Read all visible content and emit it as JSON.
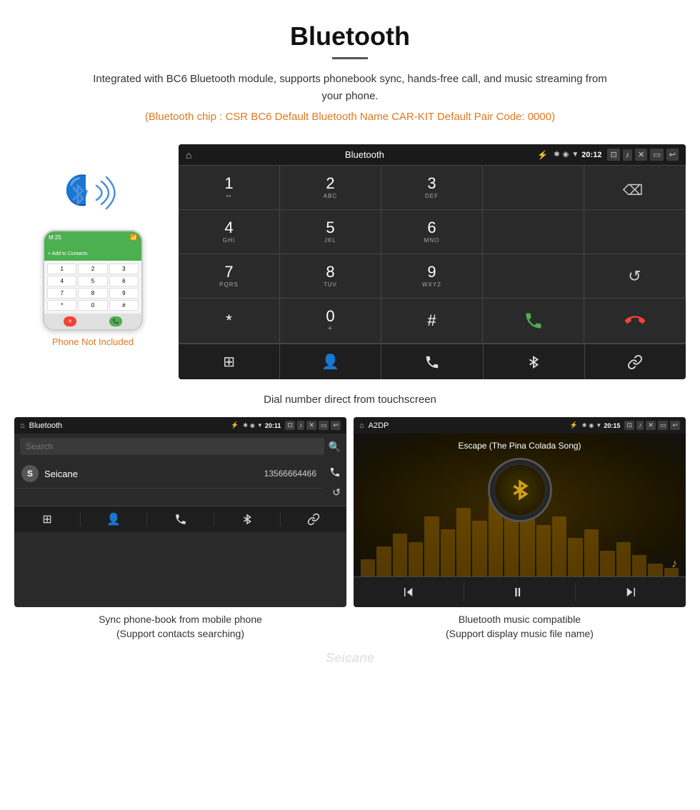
{
  "header": {
    "title": "Bluetooth",
    "description": "Integrated with BC6 Bluetooth module, supports phonebook sync, hands-free call, and music streaming from your phone.",
    "specs": "(Bluetooth chip : CSR BC6    Default Bluetooth Name CAR-KIT    Default Pair Code: 0000)"
  },
  "phone_label": "Phone Not Included",
  "dialer": {
    "title": "Bluetooth",
    "time": "20:12",
    "keys": [
      {
        "main": "1",
        "sub": ""
      },
      {
        "main": "2",
        "sub": "ABC"
      },
      {
        "main": "3",
        "sub": "DEF"
      },
      {
        "main": "",
        "sub": ""
      },
      {
        "main": "⌫",
        "sub": ""
      }
    ],
    "keys_row2": [
      {
        "main": "4",
        "sub": "GHI"
      },
      {
        "main": "5",
        "sub": "JKL"
      },
      {
        "main": "6",
        "sub": "MNO"
      },
      {
        "main": "",
        "sub": ""
      },
      {
        "main": "",
        "sub": ""
      }
    ],
    "keys_row3": [
      {
        "main": "7",
        "sub": "PQRS"
      },
      {
        "main": "8",
        "sub": "TUV"
      },
      {
        "main": "9",
        "sub": "WXYZ"
      },
      {
        "main": "",
        "sub": ""
      },
      {
        "main": "↺",
        "sub": ""
      }
    ],
    "keys_row4": [
      {
        "main": "*",
        "sub": ""
      },
      {
        "main": "0",
        "sub": "+"
      },
      {
        "main": "#",
        "sub": ""
      },
      {
        "main": "📞",
        "sub": ""
      },
      {
        "main": "📞",
        "sub": ""
      }
    ],
    "bottom_icons": [
      "⊞",
      "👤",
      "📞",
      "✱",
      "🔗"
    ]
  },
  "screen_caption": "Dial number direct from touchscreen",
  "phonebook": {
    "title": "Bluetooth",
    "time": "20:11",
    "search_placeholder": "Search",
    "contacts": [
      {
        "initial": "S",
        "name": "Seicane",
        "number": "13566664466"
      }
    ],
    "caption_line1": "Sync phone-book from mobile phone",
    "caption_line2": "(Support contacts searching)"
  },
  "music": {
    "title": "A2DP",
    "time": "20:15",
    "song_title": "Escape (The Pina Colada Song)",
    "caption_line1": "Bluetooth music compatible",
    "caption_line2": "(Support display music file name)"
  },
  "watermark": "Seicane"
}
